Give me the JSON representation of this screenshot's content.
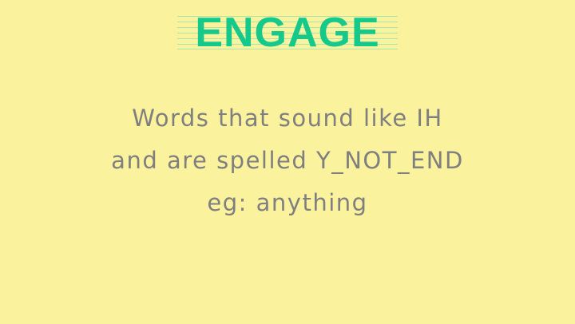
{
  "header": {
    "title": "ENGAGE"
  },
  "content": {
    "line1": "Words that sound like IH",
    "line2": "and are spelled Y_NOT_END",
    "line3": "eg: anything"
  },
  "colors": {
    "background": "#fbf29d",
    "title": "#15c98a",
    "ruled_lines": "#a8e6b0",
    "text": "#7f7f7f"
  }
}
